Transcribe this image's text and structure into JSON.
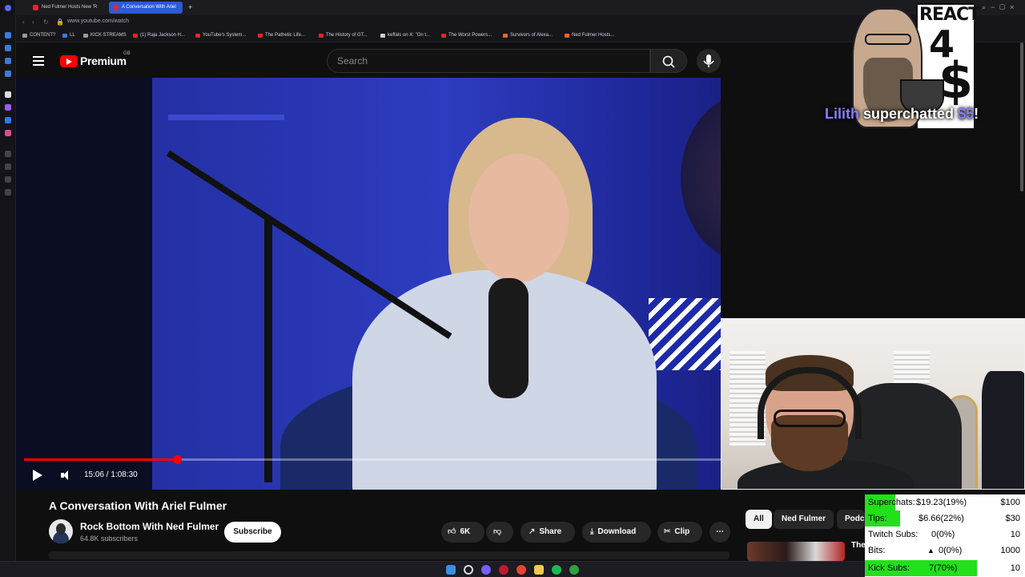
{
  "browser": {
    "tabs": [
      {
        "label": "Ned Fulmer Hosts New 'R",
        "active": false
      },
      {
        "label": "A Conversation With Ariel",
        "active": true
      }
    ],
    "url": "www.youtube.com/watch",
    "bookmarks": [
      "CONTENT?",
      "LL",
      "KICK STREAMS",
      "(1) Raja Jackson H...",
      "YouTube's System...",
      "The Pathetic Life...",
      "The History of GT...",
      "keffals on X: \"On t...",
      "The Worst Powers...",
      "Survivors of Alexa...",
      "Ned Fulmer Hosts..."
    ]
  },
  "masthead": {
    "logo_text": "Premium",
    "region": "GB",
    "search_placeholder": "Search"
  },
  "player": {
    "time": "15:06 / 1:08:30",
    "progress": 0.22
  },
  "video_info": {
    "title": "A Conversation With Ariel Fulmer",
    "channel": "Rock Bottom With Ned Fulmer",
    "subscribers": "64.8K subscribers",
    "subscribe_label": "Subscribe",
    "likes": "6K",
    "share_label": "Share",
    "download_label": "Download",
    "clip_label": "Clip",
    "more_label": "⋯"
  },
  "sidebar": {
    "chips": [
      "All",
      "Ned Fulmer",
      "Podc"
    ],
    "first_title": "The"
  },
  "overlay": {
    "react_word": "REACT",
    "react_four": "4",
    "react_dollar": "$",
    "alert_name": "Lilith",
    "alert_text": "superchatted",
    "alert_amount": "$5",
    "alert_bang": "!"
  },
  "stats": [
    {
      "label": "Superchats:",
      "value": "$19.23(19%)",
      "goal": "$100",
      "fill": 0.19
    },
    {
      "label": "Tips:",
      "value": "$6.66(22%)",
      "goal": "$30",
      "fill": 0.22
    },
    {
      "label": "Twitch Subs:",
      "value": "0(0%)",
      "goal": "10",
      "fill": 0
    },
    {
      "label": "Bits:",
      "value": "0(0%)",
      "goal": "1000",
      "fill": 0,
      "delta": "▲"
    },
    {
      "label": "Kick Subs:",
      "value": "7(70%)",
      "goal": "10",
      "fill": 0.7
    }
  ],
  "colors": {
    "yt_red": "#ff0000",
    "stat_bar": "#22e01a",
    "alert_accent": "#8a7dff"
  }
}
